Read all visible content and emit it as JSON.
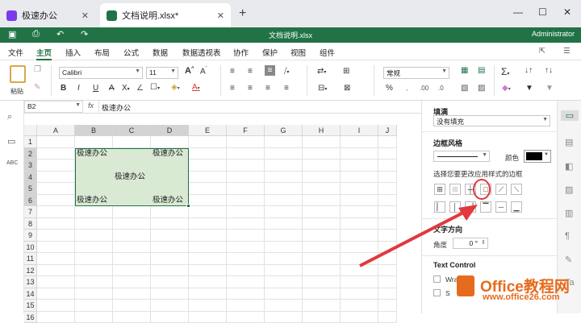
{
  "tabs": [
    {
      "label": "极速办公",
      "icon_color": "#7c3aed"
    },
    {
      "label": "文档说明.xlsx*",
      "icon_color": "#217346"
    }
  ],
  "titlebar": {
    "filename": "文档说明.xlsx",
    "user": "Administrator"
  },
  "menu": [
    "文件",
    "主页",
    "插入",
    "布局",
    "公式",
    "数据",
    "数据透视表",
    "协作",
    "保护",
    "视图",
    "组件"
  ],
  "ribbon": {
    "paste_label": "粘贴",
    "font_name": "Calibri",
    "font_size": "11",
    "number_format": "常规",
    "percent": "%"
  },
  "formula_bar": {
    "cell_ref": "B2",
    "fx": "fx",
    "value": "极速办公"
  },
  "columns": [
    "A",
    "B",
    "C",
    "D",
    "E",
    "F",
    "G",
    "H",
    "I",
    "J"
  ],
  "rows": [
    "1",
    "2",
    "3",
    "4",
    "5",
    "6",
    "7",
    "8",
    "9",
    "10",
    "11",
    "12",
    "13",
    "14",
    "15",
    "16"
  ],
  "cells": {
    "B2": "极速办公",
    "D2": "极速办公",
    "C4": "极速办公",
    "B6": "极速办公",
    "D6": "极速办公"
  },
  "panel": {
    "fill_title": "填满",
    "fill_value": "没有填充",
    "border_title": "边框风格",
    "color_label": "颜色",
    "border_hint": "选择您要更改应用样式的边框",
    "text_dir_title": "文字方向",
    "angle_label": "角度",
    "angle_value": "0 °",
    "text_control_title": "Text Control",
    "wrap_label": "Wrap",
    "shrink_label": "S"
  },
  "watermark": {
    "brand": "Office教程网",
    "url": "www.office26.com"
  },
  "colors": {
    "accent": "#217346",
    "arrow": "#e0393e",
    "selection": "#d9ead3"
  }
}
